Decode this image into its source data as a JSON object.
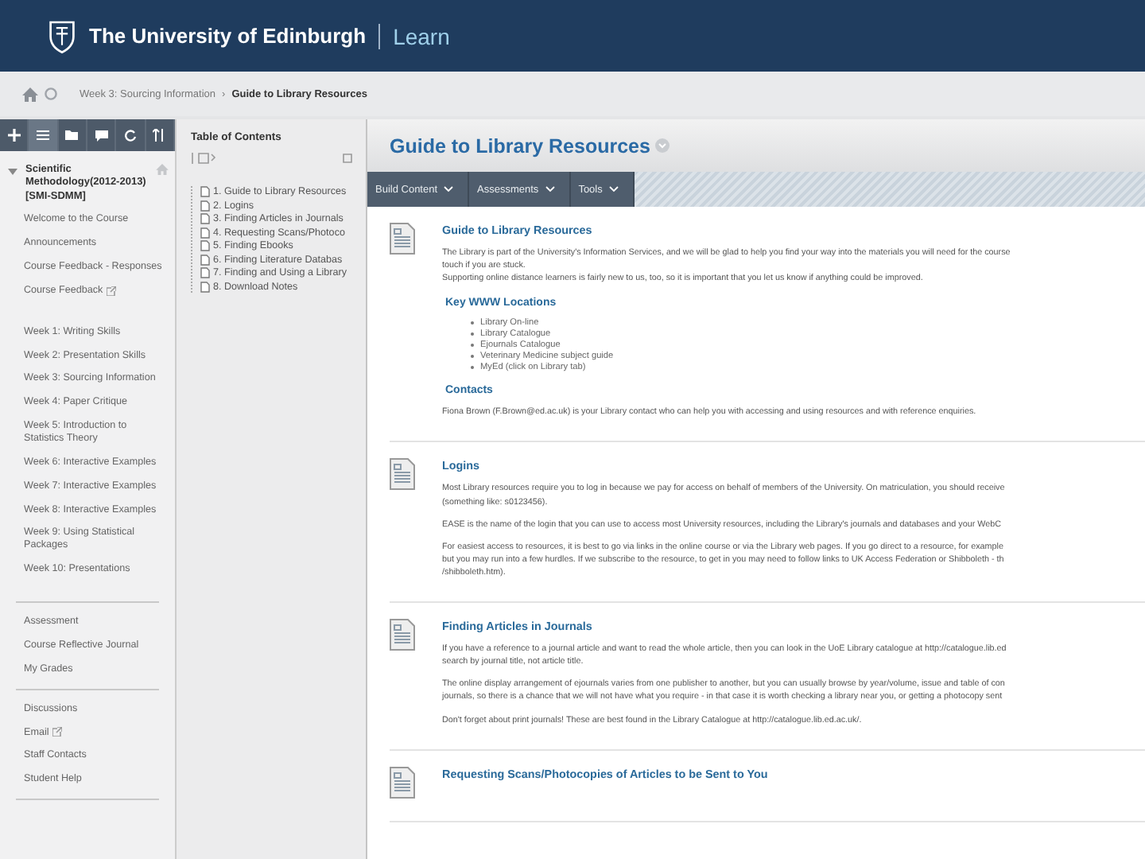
{
  "header": {
    "university": "The University of Edinburgh",
    "product": "Learn"
  },
  "breadcrumb": {
    "parent": "Week 3: Sourcing Information",
    "separator": "›",
    "current": "Guide to Library Resources"
  },
  "sidebar": {
    "tools": [
      {
        "kind": "add",
        "selected": false
      },
      {
        "kind": "list",
        "selected": true
      },
      {
        "kind": "folder",
        "selected": false
      },
      {
        "kind": "chat",
        "selected": false
      },
      {
        "kind": "refresh",
        "selected": false
      },
      {
        "kind": "sort",
        "selected": false
      }
    ],
    "course": {
      "title": "Scientific Methodology(2012-2013)[SMI-SDMM]",
      "expanded": true
    },
    "groups": [
      [
        {
          "label": "Welcome to the Course",
          "external": false
        },
        {
          "label": "Announcements",
          "external": false
        },
        {
          "label": "Course Feedback - Responses",
          "external": false
        },
        {
          "label": "Course Feedback",
          "external": true
        }
      ],
      [
        {
          "label": "Week 1: Writing Skills",
          "external": false
        },
        {
          "label": "Week 2: Presentation Skills",
          "external": false
        },
        {
          "label": "Week 3: Sourcing Information",
          "external": false
        },
        {
          "label": "Week 4: Paper Critique",
          "external": false
        },
        {
          "label": "Week 5: Introduction to Statistics Theory",
          "external": false
        },
        {
          "label": "Week 6: Interactive Examples",
          "external": false
        },
        {
          "label": "Week 7: Interactive Examples",
          "external": false
        },
        {
          "label": "Week 8: Interactive Examples",
          "external": false
        },
        {
          "label": "Week 9: Using Statistical Packages",
          "external": false
        },
        {
          "label": "Week 10: Presentations",
          "external": false
        }
      ],
      [
        {
          "label": "Assessment",
          "external": false
        },
        {
          "label": "Course Reflective Journal",
          "external": false
        },
        {
          "label": "My Grades",
          "external": false
        }
      ],
      [
        {
          "label": "Discussions",
          "external": false
        },
        {
          "label": "Email",
          "external": true
        },
        {
          "label": "Staff Contacts",
          "external": false
        },
        {
          "label": "Student Help",
          "external": false
        }
      ]
    ]
  },
  "toc": {
    "title": "Table of Contents",
    "items": [
      "1. Guide to Library Resources",
      "2. Logins",
      "3. Finding Articles in Journals",
      "4. Requesting Scans/Photoco",
      "5. Finding Ebooks",
      "6. Finding Literature Databas",
      "7. Finding and Using a Library",
      "8. Download Notes"
    ]
  },
  "page": {
    "title": "Guide to Library Resources",
    "actions": [
      "Build Content",
      "Assessments",
      "Tools"
    ],
    "items": [
      {
        "title": "Guide to Library Resources",
        "blocks": [
          {
            "kind": "text",
            "text": "The Library is part of the University's Information Services, and we will be glad to help you find your way into the materials you will need for the course\ntouch if you are stuck.\nSupporting online distance learners is fairly new to us, too, so it is important that you let us know if anything could be improved."
          },
          {
            "kind": "heading",
            "text": "Key WWW Locations"
          },
          {
            "kind": "list",
            "items": [
              "Library On-line",
              "Library Catalogue",
              "Ejournals Catalogue",
              "Veterinary Medicine subject guide",
              "MyEd (click on Library tab)"
            ]
          },
          {
            "kind": "heading",
            "text": "Contacts"
          },
          {
            "kind": "text",
            "text": "Fiona Brown (F.Brown@ed.ac.uk) is your Library contact who can help you with accessing and using resources and with reference enquiries."
          }
        ]
      },
      {
        "title": "Logins",
        "blocks": [
          {
            "kind": "text",
            "text": "Most Library resources require you to log in because we pay for access on behalf of members of the University. On matriculation, you should receive\n(something like: s0123456)."
          },
          {
            "kind": "text",
            "text": "EASE is the name of the login that you can use to access most University resources, including the Library's journals and databases and your WebC"
          },
          {
            "kind": "text",
            "text": "For easiest access to resources, it is best to go via links in the online course or via the Library web pages. If you go direct to a resource, for example\nbut you may run into a few hurdles. If we subscribe to the resource, to get in you may need to follow links to UK Access Federation or Shibboleth - th\n/shibboleth.htm)."
          }
        ]
      },
      {
        "title": "Finding Articles in Journals",
        "blocks": [
          {
            "kind": "text",
            "text": "If you have a reference to a journal article and want to read the whole article, then you can look in the UoE Library catalogue at http://catalogue.lib.ed\nsearch by journal title, not article title."
          },
          {
            "kind": "text",
            "text": "The online display arrangement of ejournals varies from one publisher to another, but you can usually browse by year/volume, issue and table of con\njournals, so there is a chance that we will not have what you require - in that case it is worth checking a library near you, or getting a photocopy sent"
          },
          {
            "kind": "text",
            "text": "Don't forget about print journals! These are best found in the Library Catalogue at http://catalogue.lib.ed.ac.uk/."
          }
        ]
      },
      {
        "title": "Requesting Scans/Photocopies of Articles to be Sent to You"
      }
    ]
  }
}
